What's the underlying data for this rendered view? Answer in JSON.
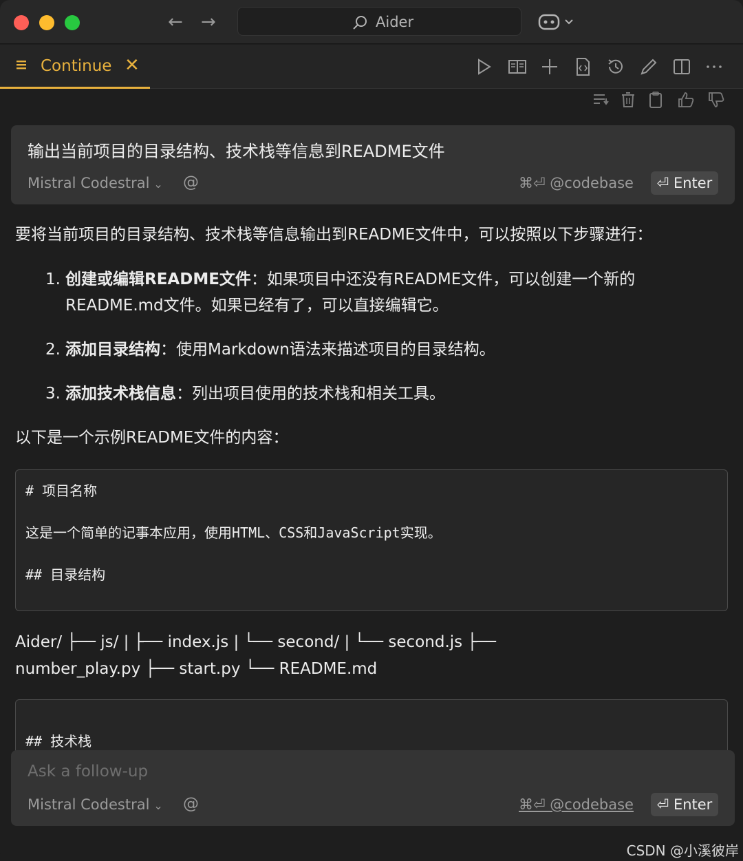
{
  "titlebar": {
    "search_text": "Aider"
  },
  "tab": {
    "label": "Continue"
  },
  "prompt_card": {
    "text": "输出当前项目的目录结构、技术栈等信息到README文件",
    "model": "Mistral Codestral",
    "at_symbol": "@",
    "shortcut": "⌘⏎ @codebase",
    "enter_label": "⏎ Enter"
  },
  "response": {
    "intro": "要将当前项目的目录结构、技术栈等信息输出到README文件中，可以按照以下步骤进行：",
    "steps": [
      {
        "num": "1.",
        "title": "创建或编辑README文件",
        "text_line1": "：如果项目中还没有README文件，可以创建一个新的",
        "text_line2": "README.md文件。如果已经有了，可以直接编辑它。"
      },
      {
        "num": "2.",
        "title": "添加目录结构",
        "text_line1": "：使用Markdown语法来描述项目的目录结构。"
      },
      {
        "num": "3.",
        "title": "添加技术栈信息",
        "text_line1": "：列出项目使用的技术栈和相关工具。"
      }
    ],
    "example_intro": "以下是一个示例README文件的内容：",
    "code1": {
      "line1": "# 项目名称",
      "line2": "这是一个简单的记事本应用，使用HTML、CSS和JavaScript实现。",
      "line3": "## 目录结构"
    },
    "tree_line1": "Aider/ ├── js/ | ├── index.js | └── second/ | └── second.js ├──",
    "tree_line2": "number_play.py ├── start.py └── README.md",
    "code2": {
      "line1": "## 技术栈"
    }
  },
  "followup_card": {
    "placeholder": "Ask a follow-up",
    "model": "Mistral Codestral",
    "at_symbol": "@",
    "shortcut": "⌘⏎ @codebase",
    "enter_label": "⏎ Enter"
  },
  "watermark": "CSDN @小溪彼岸",
  "colors": {
    "accent": "#e8b13d",
    "background": "#1e1e1e",
    "card": "#343434"
  }
}
